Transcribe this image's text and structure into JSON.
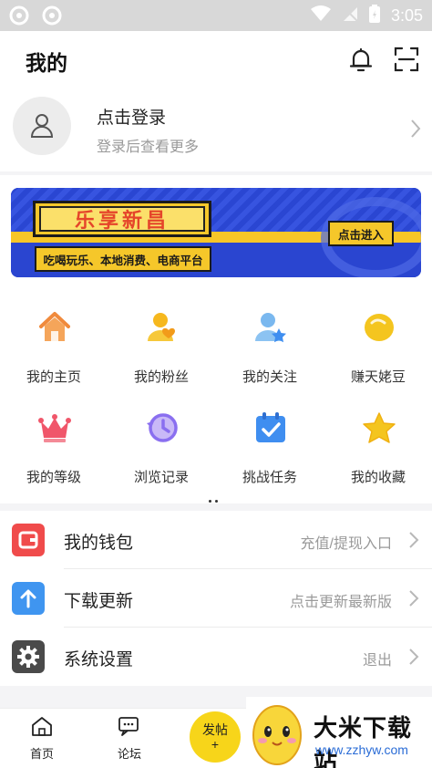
{
  "status_bar": {
    "time": "3:05"
  },
  "header": {
    "title": "我的"
  },
  "login": {
    "title": "点击登录",
    "subtitle": "登录后查看更多"
  },
  "banner": {
    "title": "乐享新昌",
    "subtitle": "吃喝玩乐、本地消费、电商平台",
    "button": "点击进入"
  },
  "grid": [
    {
      "label": "我的主页",
      "icon": "home-icon",
      "color": "#f08a3c"
    },
    {
      "label": "我的粉丝",
      "icon": "fans-icon",
      "color": "#f6b81e"
    },
    {
      "label": "我的关注",
      "icon": "follow-icon",
      "color": "#5fa8e8"
    },
    {
      "label": "赚天姥豆",
      "icon": "bean-icon",
      "color": "#f4c51f"
    },
    {
      "label": "我的等级",
      "icon": "crown-icon",
      "color": "#f0566a"
    },
    {
      "label": "浏览记录",
      "icon": "history-icon",
      "color": "#8a6ff0"
    },
    {
      "label": "挑战任务",
      "icon": "task-icon",
      "color": "#3f8ef0"
    },
    {
      "label": "我的收藏",
      "icon": "star-icon",
      "color": "#f4c51f"
    }
  ],
  "list": [
    {
      "label": "我的钱包",
      "value": "充值/提现入口",
      "icon": "wallet-icon",
      "color": "#f04b4b"
    },
    {
      "label": "下载更新",
      "value": "点击更新最新版",
      "icon": "upload-icon",
      "color": "#3f95f0"
    },
    {
      "label": "系统设置",
      "value": "退出",
      "icon": "gear-icon",
      "color": "#4a4a4a"
    }
  ],
  "bottom_nav": {
    "home": "首页",
    "forum": "论坛",
    "post": "发帖",
    "post_plus": "+"
  },
  "watermark": {
    "title": "大米下载站",
    "url": "www.zzhyw.com"
  }
}
